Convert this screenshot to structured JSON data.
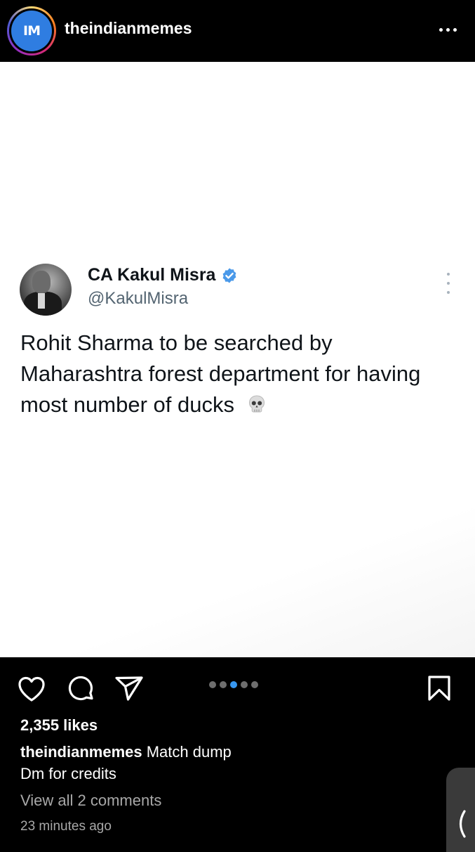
{
  "header": {
    "avatar_initials": "IM",
    "username": "theindianmemes",
    "more_icon": "ellipsis-horizontal-icon"
  },
  "post": {
    "tweet": {
      "display_name": "CA Kakul Misra",
      "handle": "@KakulMisra",
      "verified": true,
      "verified_color": "#4a99e9",
      "text": "Rohit Sharma to be searched by Maharashtra forest department for having most number of ducks",
      "emoji": "💀",
      "menu_icon": "ellipsis-vertical-icon"
    }
  },
  "actions": {
    "like_icon": "heart-icon",
    "comment_icon": "speech-bubble-icon",
    "share_icon": "paper-plane-icon",
    "save_icon": "bookmark-icon",
    "carousel": {
      "total": 5,
      "active_index": 2,
      "active_color": "#3797f0"
    }
  },
  "engagement": {
    "likes": "2,355 likes",
    "caption_user": "theindianmemes",
    "caption_line1": "Match dump",
    "caption_line2": "Dm for credits",
    "view_comments": "View all 2 comments",
    "timestamp": "23 minutes ago"
  },
  "side_tab_icon": "chevron-left-icon"
}
